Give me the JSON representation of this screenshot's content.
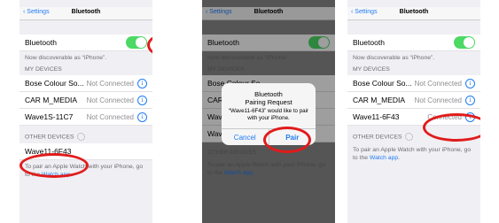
{
  "nav": {
    "back": "Settings",
    "title": "Bluetooth"
  },
  "bluetooth_label": "Bluetooth",
  "discoverable": "Now discoverable as “iPhone”.",
  "my_devices_header": "MY DEVICES",
  "other_devices_header": "OTHER DEVICES",
  "devices": [
    {
      "name": "Bose Colour So...",
      "status": "Not Connected"
    },
    {
      "name": "CAR M_MEDIA",
      "status": "Not Connected"
    },
    {
      "name": "Wave1S-11C7",
      "status": "Not Connected"
    }
  ],
  "panel3_wave": {
    "name": "Wave11-6F43",
    "status": "Connected"
  },
  "other_device": "Wave11-6F43",
  "watch_note_prefix": "To pair an Apple Watch with your iPhone, go to the ",
  "watch_link": "Watch app",
  "alert": {
    "title_line1": "Bluetooth",
    "title_line2": "Pairing Request",
    "message": "“Wave11-6F43” would like to pair with your iPhone.",
    "cancel": "Cancel",
    "pair": "Pair"
  },
  "colors": {
    "accent": "#1f7cf5",
    "toggle_on": "#4cd964",
    "highlight": "#e11b1b"
  }
}
